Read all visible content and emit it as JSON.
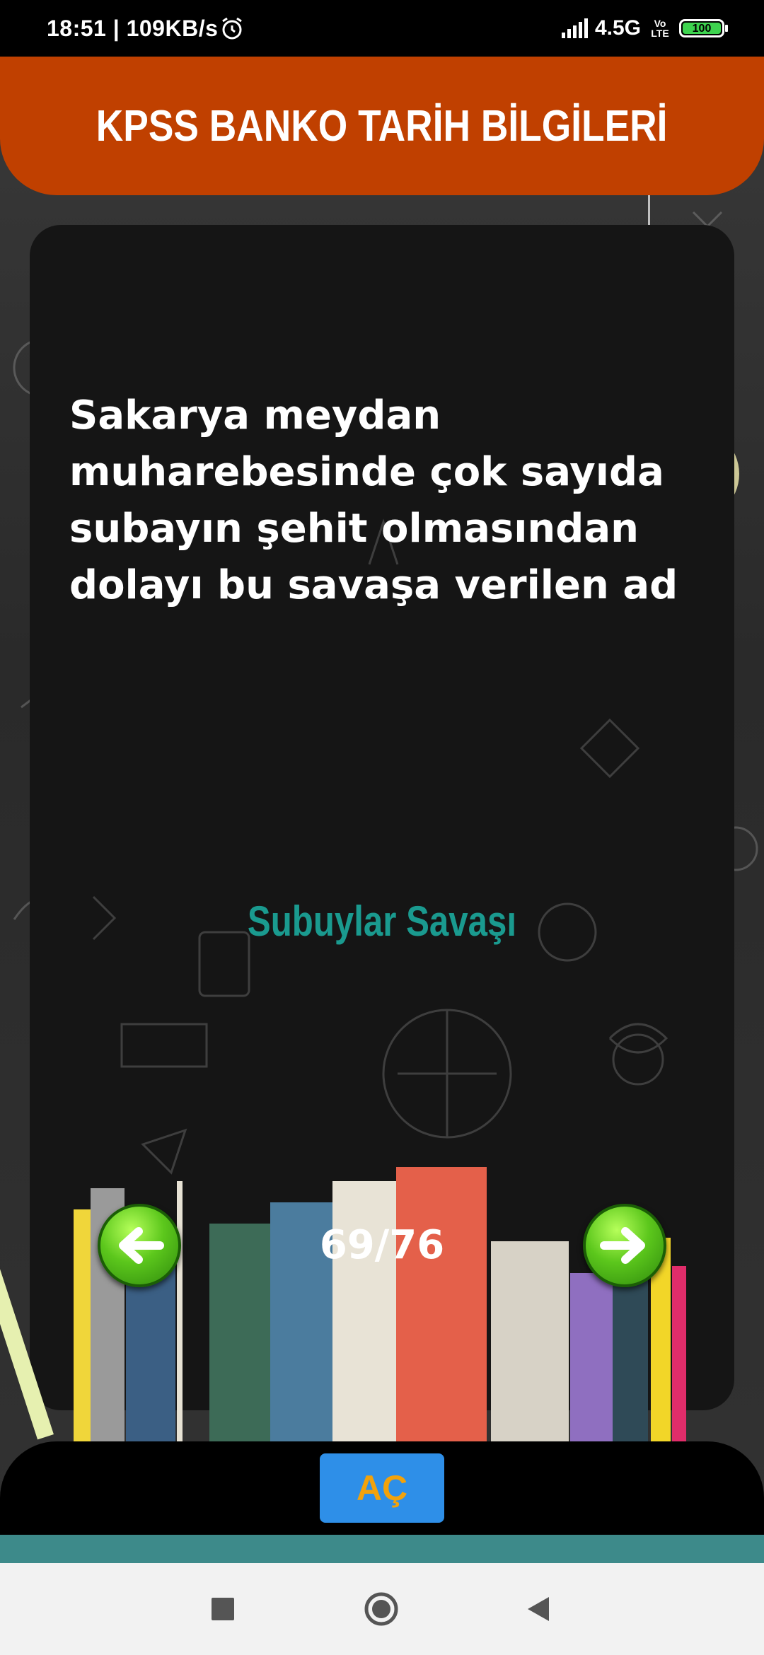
{
  "status_bar": {
    "time": "18:51 | 109KB/s",
    "network": "4.5G",
    "volte_top": "Vo",
    "volte_bottom": "LTE",
    "battery": "100",
    "battery_color": "#3ed34f"
  },
  "header": {
    "title": "KPSS BANKO TARİH BİLGİLERİ",
    "color": "#c04000"
  },
  "card": {
    "question": "Sakarya meydan muharebesinde çok sayıda subayın şehit olmasından dolayı bu savaşa verilen ad",
    "answer": "Subuylar Savaşı",
    "answer_color": "#1a9a8f"
  },
  "navigation": {
    "counter": "69/76",
    "prev_icon": "arrow-left-icon",
    "next_icon": "arrow-right-icon"
  },
  "actions": {
    "open_label": "AÇ",
    "open_color": "#2e8fe8"
  },
  "system_nav": {
    "recent_icon": "square-icon",
    "home_icon": "circle-icon",
    "back_icon": "triangle-back-icon"
  }
}
